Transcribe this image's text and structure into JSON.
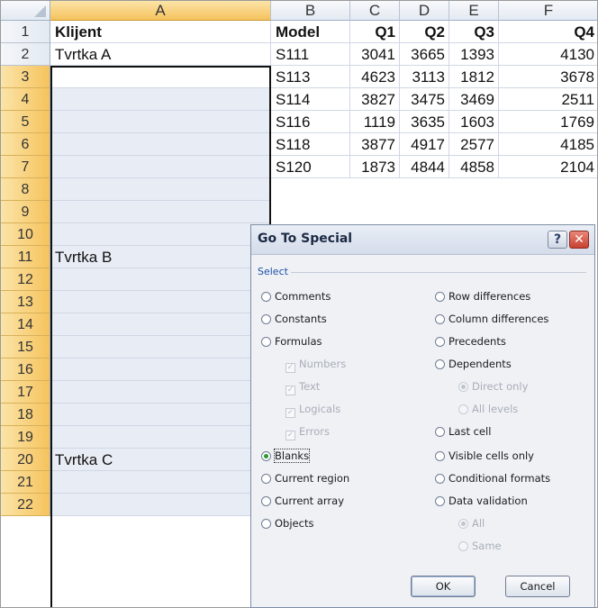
{
  "sheet": {
    "columns": [
      "A",
      "B",
      "C",
      "D",
      "E",
      "F"
    ],
    "rows": [
      "1",
      "2",
      "3",
      "4",
      "5",
      "6",
      "7",
      "8",
      "9",
      "10",
      "11",
      "12",
      "13",
      "14",
      "15",
      "16",
      "17",
      "18",
      "19",
      "20",
      "21",
      "22"
    ],
    "header_row": [
      "Klijent",
      "Model",
      "Q1",
      "Q2",
      "Q3",
      "Q4"
    ],
    "col_a": {
      "r2": "Tvrtka A",
      "r11": "Tvrtka B",
      "r20": "Tvrtka C"
    },
    "data_rows": [
      [
        "S111",
        "3041",
        "3665",
        "1393",
        "4130"
      ],
      [
        "S113",
        "4623",
        "3113",
        "1812",
        "3678"
      ],
      [
        "S114",
        "3827",
        "3475",
        "3469",
        "2511"
      ],
      [
        "S116",
        "1119",
        "3635",
        "1603",
        "1769"
      ],
      [
        "S118",
        "3877",
        "4917",
        "2577",
        "4185"
      ],
      [
        "S120",
        "1873",
        "4844",
        "4858",
        "2104"
      ]
    ]
  },
  "dialog": {
    "title": "Go To Special",
    "help_glyph": "?",
    "close_glyph": "✕",
    "group_label": "Select",
    "left_options": [
      "Comments",
      "Constants",
      "Formulas"
    ],
    "formula_checks": [
      "Numbers",
      "Text",
      "Logicals",
      "Errors"
    ],
    "left_options_2": [
      "Blanks",
      "Current region",
      "Current array",
      "Objects"
    ],
    "right_options": [
      "Row differences",
      "Column differences",
      "Precedents",
      "Dependents"
    ],
    "dependents_sub": [
      "Direct only",
      "All levels"
    ],
    "right_options_2": [
      "Last cell",
      "Visible cells only",
      "Conditional formats",
      "Data validation"
    ],
    "validation_sub": [
      "All",
      "Same"
    ],
    "selected_option": "Blanks",
    "ok_label": "OK",
    "cancel_label": "Cancel"
  }
}
